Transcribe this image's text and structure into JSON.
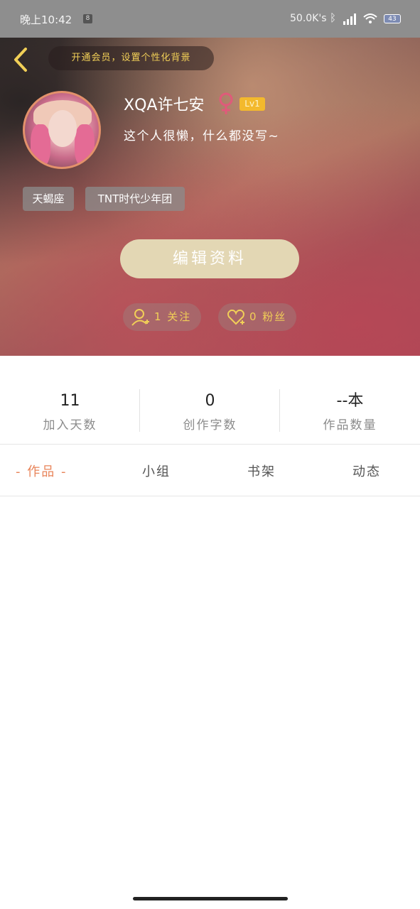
{
  "status_bar": {
    "time": "晚上10:42",
    "notification_badge": "8",
    "net_speed": "50.0K's",
    "battery": "43"
  },
  "header": {
    "vip_banner": "开通会员，设置个性化背景",
    "username": "XQA许七安",
    "level": "Lv1",
    "bio": "这个人很懒，什么都没写~",
    "tags": [
      "天蝎座",
      "TNT时代少年团"
    ],
    "edit_button": "编辑资料",
    "following": "1 关注",
    "followers": "0 粉丝"
  },
  "stats": [
    {
      "value": "11",
      "label": "加入天数"
    },
    {
      "value": "0",
      "label": "创作字数"
    },
    {
      "value": "--本",
      "label": "作品数量"
    }
  ],
  "tabs": [
    {
      "label": "- 作品 -",
      "active": true
    },
    {
      "label": "小组",
      "active": false
    },
    {
      "label": "书架",
      "active": false
    },
    {
      "label": "动态",
      "active": false
    }
  ],
  "colors": {
    "accent": "#e8845a",
    "gold": "#f1cf57",
    "edit_button_bg": "#e3d7b4",
    "level_badge": "#f3b92d",
    "female_icon": "#e05a7a"
  }
}
